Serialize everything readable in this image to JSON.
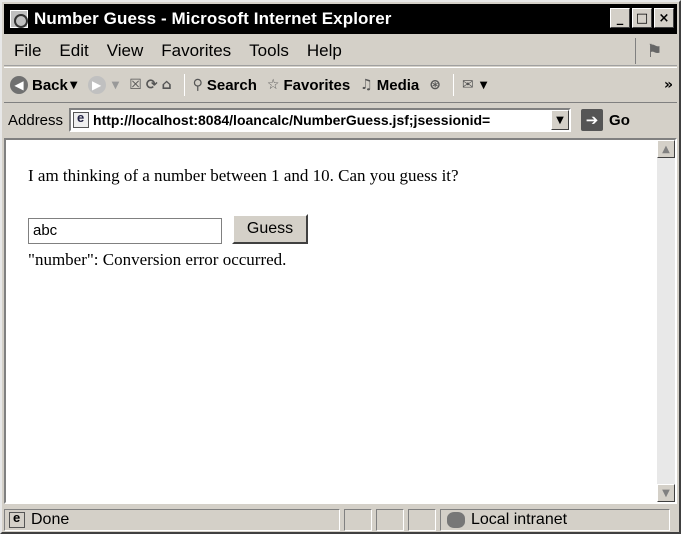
{
  "window": {
    "title": "Number Guess - Microsoft Internet Explorer",
    "controls": {
      "minimize": "_",
      "maximize": "□",
      "close": "×"
    }
  },
  "menubar": {
    "items": [
      "File",
      "Edit",
      "View",
      "Favorites",
      "Tools",
      "Help"
    ]
  },
  "toolbar": {
    "back_label": "Back",
    "search_label": "Search",
    "favorites_label": "Favorites",
    "media_label": "Media"
  },
  "addressbar": {
    "label": "Address",
    "url": "http://localhost:8084/loancalc/NumberGuess.jsf;jsessionid=",
    "go_label": "Go"
  },
  "page": {
    "prompt": "I am thinking of a number between 1 and 10. Can you guess it?",
    "input_value": "abc",
    "button_label": "Guess",
    "error": "\"number\": Conversion error occurred."
  },
  "statusbar": {
    "status": "Done",
    "zone": "Local intranet"
  }
}
